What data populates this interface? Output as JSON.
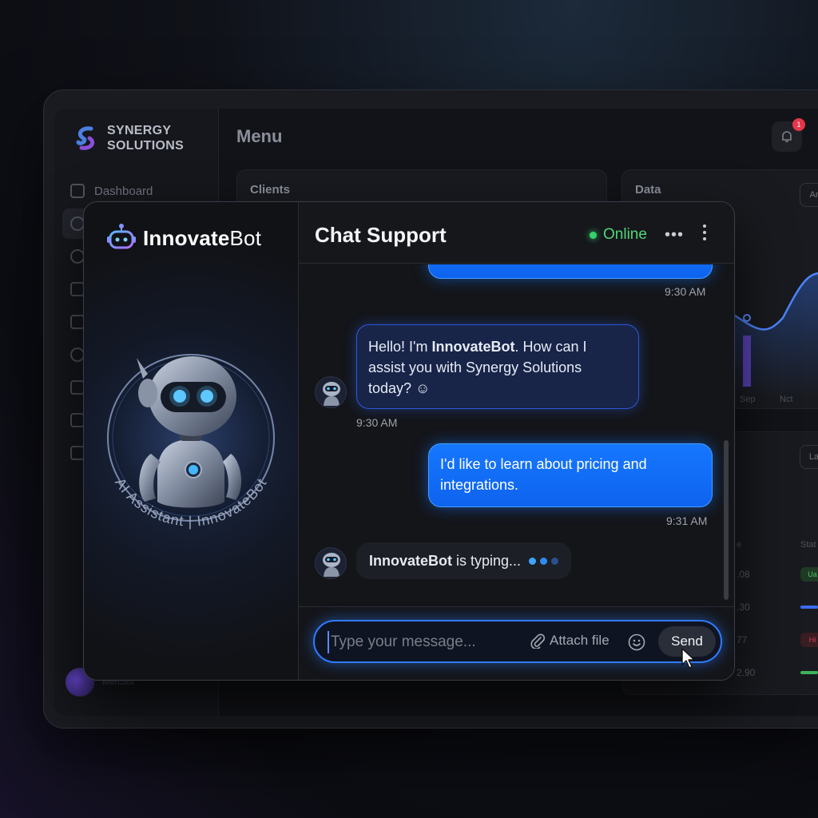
{
  "dashboard": {
    "brand_line1": "SYNERGY",
    "brand_line2": "SOLUTIONS",
    "menu_title": "Menu",
    "nav": [
      {
        "label": "Dashboard",
        "icon": "grid-icon"
      },
      {
        "label": "",
        "icon": "users-icon"
      },
      {
        "label": "",
        "icon": "pie-icon"
      },
      {
        "label": "",
        "icon": "bar-chart-icon"
      },
      {
        "label": "",
        "icon": "briefcase-icon"
      },
      {
        "label": "",
        "icon": "headset-icon"
      },
      {
        "label": "",
        "icon": "analytics-icon"
      },
      {
        "label": "",
        "icon": "list-icon"
      },
      {
        "label": "",
        "icon": "logout-icon"
      }
    ],
    "notification_count": "1",
    "user_name": "Mercata",
    "panels": {
      "clients_title": "Clients",
      "data_title": "Data",
      "data_button": "Ar",
      "chart_ticks": [
        "Sep",
        "Nct"
      ],
      "table_button": "La",
      "table_col1": "e",
      "table_col2": "Stat",
      "table_values": [
        ".08",
        ".30",
        "77",
        "2.90"
      ],
      "status_tags": [
        "Ua",
        "Hi"
      ]
    }
  },
  "bot_panel": {
    "brand_bold": "Innovate",
    "brand_light": "Bot",
    "ring_caption": "AI Assistant | InnovateBot"
  },
  "chat": {
    "title": "Chat Support",
    "status": "Online",
    "more_label": "•••",
    "messages": [
      {
        "from": "user",
        "time": "9:30 AM"
      },
      {
        "from": "bot",
        "text_pre": "Hello! I'm ",
        "text_bold": "InnovateBot",
        "text_post": ". How can I assist you with Synergy Solutions today? ☺",
        "time": "9:30 AM"
      },
      {
        "from": "user",
        "text": "I'd like to learn about pricing and integrations.",
        "time": "9:31 AM"
      }
    ],
    "typing_name": "InnovateBot",
    "typing_text": " is typing...",
    "input_placeholder": "Type your message...",
    "attach_label": "Attach file",
    "send_label": "Send"
  },
  "colors": {
    "accent_blue": "#1677ff",
    "online_green": "#37d06b",
    "typing_dot_1": "#3ea4ff",
    "typing_dot_2": "#2d8cf0",
    "typing_dot_3": "#2b4f8f",
    "badge_red": "#e5364a"
  }
}
